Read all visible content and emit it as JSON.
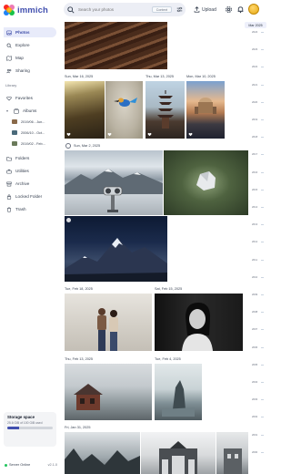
{
  "app": {
    "name": "immich"
  },
  "search": {
    "placeholder": "Search your photos",
    "context_chip": "Context"
  },
  "header": {
    "upload_label": "Upload"
  },
  "sidebar": {
    "items": [
      {
        "id": "photos",
        "label": "Photos",
        "icon": "image-icon"
      },
      {
        "id": "explore",
        "label": "Explore",
        "icon": "magnify-icon"
      },
      {
        "id": "map",
        "label": "Map",
        "icon": "map-icon"
      },
      {
        "id": "sharing",
        "label": "Sharing",
        "icon": "people-icon"
      }
    ],
    "library_label": "Library",
    "library_items": [
      {
        "id": "favorites",
        "label": "Favorites",
        "icon": "heart-icon"
      },
      {
        "id": "albums",
        "label": "Albums",
        "icon": "album-icon"
      }
    ],
    "albums": [
      {
        "label": "2019/06 - Jun...",
        "color": "#8a6a4a"
      },
      {
        "label": "2006/10 - Oct...",
        "color": "#4a6a7a"
      },
      {
        "label": "2019/02 - Feb...",
        "color": "#6a7a5a"
      }
    ],
    "more_items": [
      {
        "id": "folders",
        "label": "Folders",
        "icon": "folder-icon"
      },
      {
        "id": "utilities",
        "label": "Utilities",
        "icon": "toolbox-icon"
      },
      {
        "id": "archive",
        "label": "Archive",
        "icon": "archive-icon"
      },
      {
        "id": "locked",
        "label": "Locked Folder",
        "icon": "lock-icon"
      },
      {
        "id": "trash",
        "label": "Trash",
        "icon": "trash-icon"
      }
    ],
    "storage": {
      "title": "Storage space",
      "usage": "25.6 GiB of 100 GiB used",
      "fraction": 0.26
    },
    "server": {
      "status": "Server Online",
      "version": "v2.1.0"
    }
  },
  "timeline": {
    "groups": [
      {
        "date": "Sun, Mar 16, 2025"
      },
      {
        "date": "Thu, Mar 13, 2025"
      },
      {
        "date": "Mon, Mar 10, 2025"
      },
      {
        "date": "Sun, Mar 2, 2025"
      },
      {
        "date": "Tue, Feb 18, 2025"
      },
      {
        "date": "Sat, Feb 15, 2025"
      },
      {
        "date": "Thu, Feb 13, 2025"
      },
      {
        "date": "Tue, Feb 4, 2025"
      },
      {
        "date": "Fri, Jan 31, 2025"
      }
    ]
  },
  "scrubber": {
    "current": "Mar 2025",
    "labels": [
      "2024",
      "2023",
      "2022",
      "2021",
      "2020",
      "2019",
      "2018",
      "2017",
      "2016",
      "2015",
      "2014",
      "2013",
      "2012",
      "2011",
      "2010",
      "2009",
      "2008",
      "2007",
      "2006",
      "2005",
      "2004",
      "2003",
      "2002",
      "2001",
      "2000"
    ]
  },
  "colors": {
    "accent": "#4250af",
    "active_bg": "#e8ebfa",
    "online": "#22c55e"
  }
}
